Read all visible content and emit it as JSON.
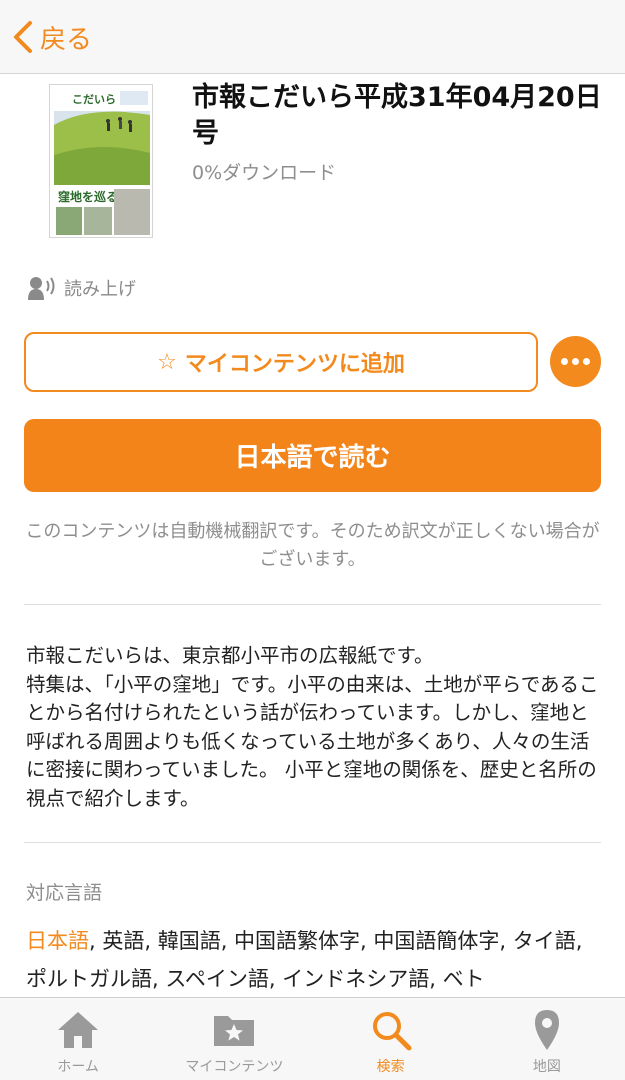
{
  "nav": {
    "back_label": "戻る"
  },
  "content": {
    "title": "市報こだいら平成31年04月20日号",
    "downloads": "0%ダウンロード",
    "cover_masthead": "こだいら",
    "cover_headline": "窪地を巡る"
  },
  "read_aloud": {
    "label": "読み上げ"
  },
  "actions": {
    "add_label": "マイコンテンツに追加",
    "read_label": "日本語で読む"
  },
  "disclaimer": "このコンテンツは自動機械翻訳です。そのため訳文が正しくない場合がございます。",
  "description": "市報こだいらは、東京都小平市の広報紙です。\n特集は、「小平の窪地」です。小平の由来は、土地が平らであることから名付けられたという話が伝わっています。しかし、窪地と呼ばれる周囲よりも低くなっている土地が多くあり、人々の生活に密接に関わっていました。 小平と窪地の関係を、歴史と名所の視点で紹介します。",
  "languages": {
    "heading": "対応言語",
    "current": "日本語",
    "others": ", 英語, 韓国語, 中国語繁体字, 中国語簡体字, タイ語, ポルトガル語, スペイン語, インドネシア語, ベト"
  },
  "tabs": [
    {
      "label": "ホーム",
      "icon": "home-icon"
    },
    {
      "label": "マイコンテンツ",
      "icon": "star-folder-icon"
    },
    {
      "label": "検索",
      "icon": "search-icon",
      "active": true
    },
    {
      "label": "地図",
      "icon": "map-pin-icon"
    }
  ],
  "colors": {
    "accent": "#f28a1e",
    "read_button": "#f2841a"
  }
}
